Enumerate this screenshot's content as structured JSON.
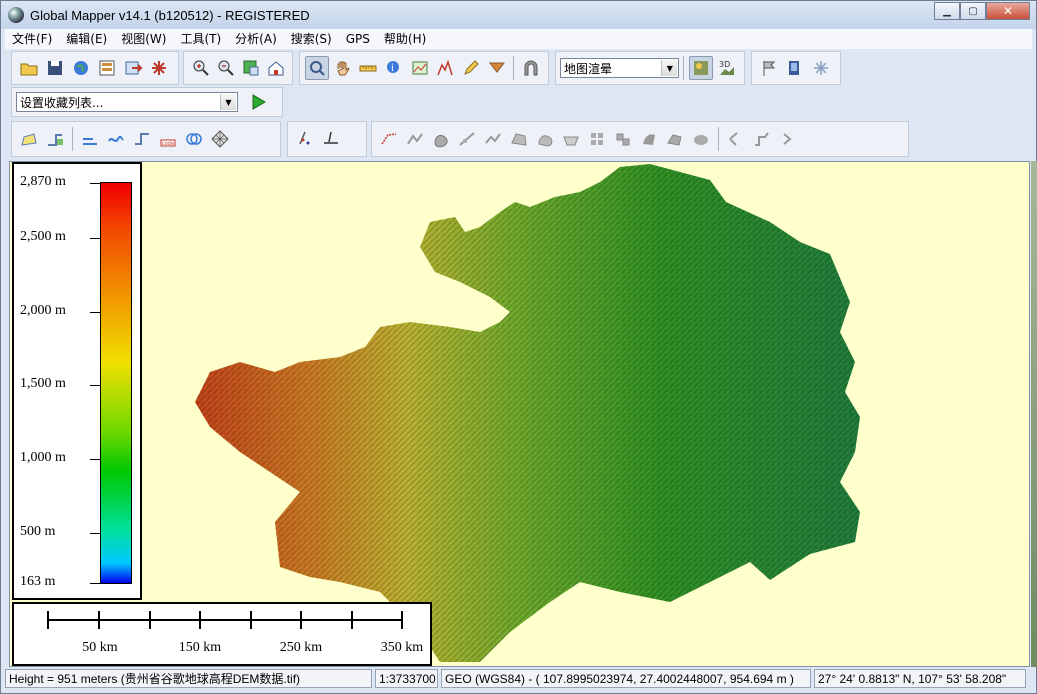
{
  "window": {
    "title": "Global Mapper v14.1 (b120512) - REGISTERED"
  },
  "menu": [
    "文件(F)",
    "编辑(E)",
    "视图(W)",
    "工具(T)",
    "分析(A)",
    "搜索(S)",
    "GPS",
    "帮助(H)"
  ],
  "toolbar": {
    "render_mode_select": "地图渲晕",
    "favorites_select": "设置收藏列表..."
  },
  "icons": {
    "row1": [
      "open-folder-icon",
      "save-icon",
      "globe-icon",
      "layer-control-icon",
      "export-icon",
      "config-icon",
      "zoom-in-icon",
      "zoom-out-icon",
      "zoom-full-icon",
      "home-icon",
      "zoom-tool-icon",
      "pan-hand-icon",
      "measure-icon",
      "info-tool-icon",
      "digitizer-icon",
      "path-profile-icon",
      "pencil-icon",
      "view-shed-icon",
      "tunnel-icon",
      "shader-icon",
      "3d-view-icon",
      "flag-icon",
      "grid-icon",
      "gps-icon"
    ],
    "row3": [
      "create-area-icon",
      "create-line-icon",
      "edit-vertex-icon",
      "combine-icon",
      "feature-icon",
      "code-icon",
      "circle-icon",
      "grid-feature-icon",
      "point-edit-icon",
      "line-edit-icon",
      "line-style-icon",
      "vertex-move-icon",
      "area-a-icon",
      "line-cut-icon",
      "line-join-icon",
      "area-b-icon",
      "area-c-icon",
      "area-d-icon",
      "area-e-icon",
      "area-f-icon",
      "area-g-icon",
      "area-h-icon",
      "area-i-icon",
      "line-a-icon",
      "line-b-icon",
      "line-c-icon"
    ]
  },
  "legend": {
    "labels": [
      "2,870 m",
      "2,500 m",
      "2,000 m",
      "1,500 m",
      "1,000 m",
      "500 m",
      "163 m"
    ],
    "values": [
      2870,
      2500,
      2000,
      1500,
      1000,
      500,
      163
    ],
    "min": 163,
    "max": 2870,
    "colors": [
      "#0000f0",
      "#00c8ff",
      "#00e0a0",
      "#00c800",
      "#70d800",
      "#f0e000",
      "#f29000",
      "#f24a00",
      "#f00000"
    ]
  },
  "scalebar": {
    "labels": [
      "50 km",
      "150 km",
      "250 km",
      "350 km"
    ]
  },
  "status": {
    "height": "Height = 951 meters (贵州省谷歌地球高程DEM数据.tif)",
    "scale": "1:3733700",
    "projection": "GEO (WGS84) - ( 107.8995023974, 27.4002448007, 954.694 m )",
    "dms": "27° 24' 0.8813\" N, 107° 53' 58.208\""
  },
  "colors": {
    "map_background": "#ffffcc",
    "terrain_low": "#1a8f1a",
    "terrain_mid": "#b8c828",
    "terrain_high": "#c83818"
  }
}
